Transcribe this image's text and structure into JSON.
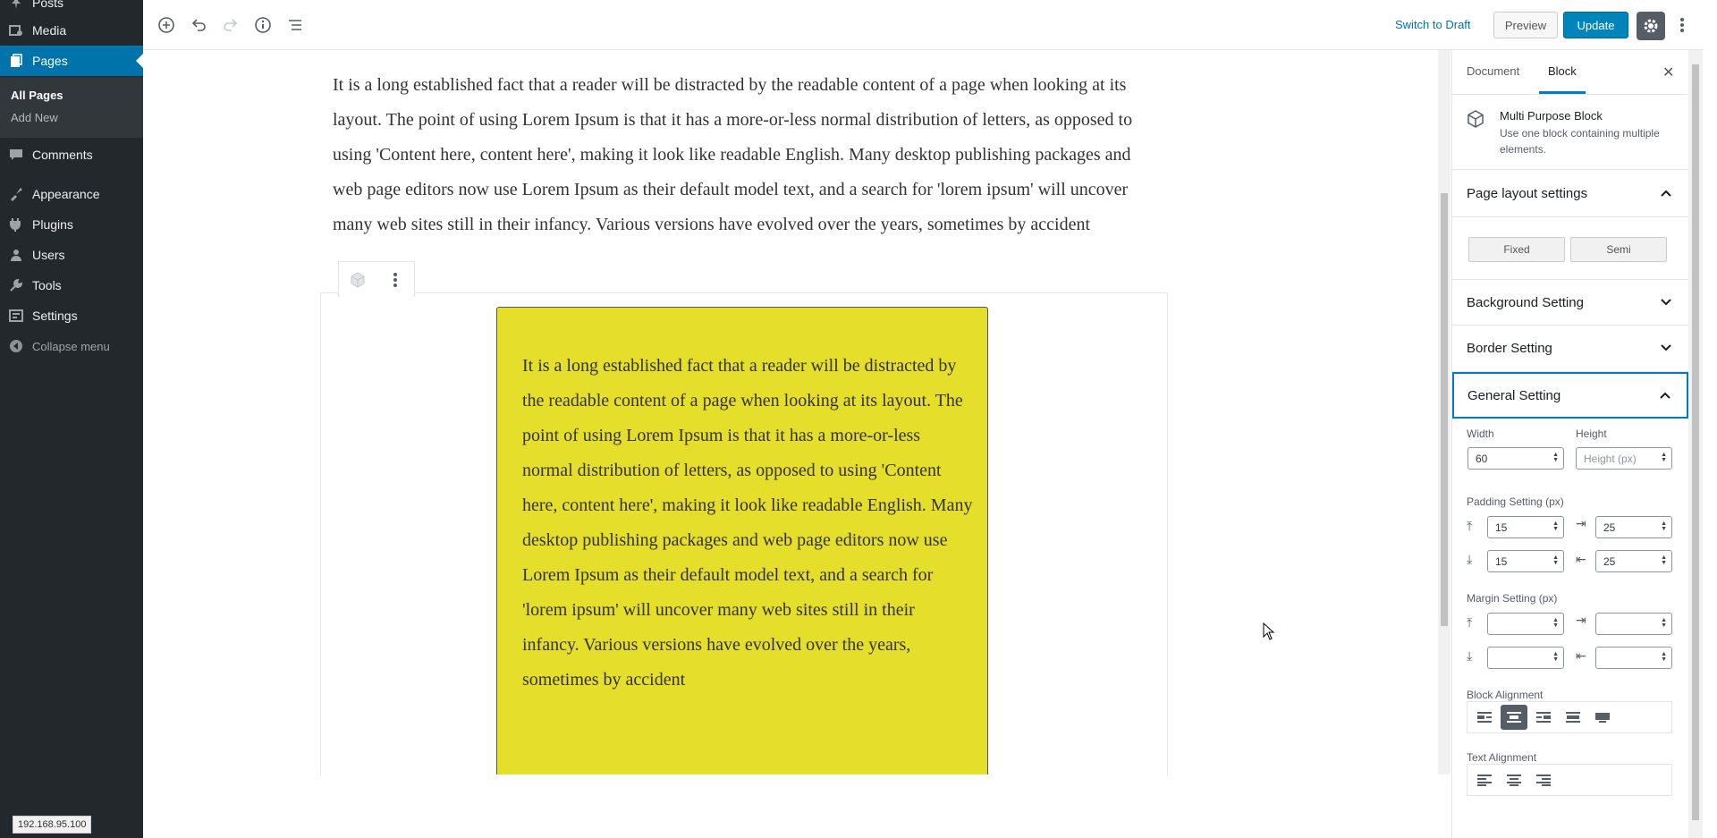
{
  "admin_menu": {
    "items": [
      {
        "label": "Posts",
        "icon": "pushpin-icon"
      },
      {
        "label": "Media",
        "icon": "media-icon"
      },
      {
        "label": "Pages",
        "icon": "pages-icon",
        "current": true
      },
      {
        "label": "Comments",
        "icon": "comments-icon"
      },
      {
        "label": "Appearance",
        "icon": "appearance-icon"
      },
      {
        "label": "Plugins",
        "icon": "plugins-icon"
      },
      {
        "label": "Users",
        "icon": "users-icon"
      },
      {
        "label": "Tools",
        "icon": "tools-icon"
      },
      {
        "label": "Settings",
        "icon": "settings-icon"
      }
    ],
    "submenu": [
      "All Pages",
      "Add New"
    ],
    "collapse_label": "Collapse menu"
  },
  "status_url": "192.168.95.100",
  "toolbar": {
    "switch_draft": "Switch to Draft",
    "preview": "Preview",
    "update": "Update"
  },
  "content": {
    "paragraph": "It is a long established fact that a reader will be distracted by the readable content of a page when looking at its layout. The point of using Lorem Ipsum is that it has a more-or-less normal distribution of letters, as opposed to using 'Content here, content here', making it look like readable English. Many desktop publishing packages and web page editors now use Lorem Ipsum as their default model text, and a search for 'lorem ipsum' will uncover many web sites still in their infancy. Various versions have evolved over the years, sometimes by accident",
    "block_text": " It is a long established fact that a reader will be distracted by the readable content of a page when looking at its layout. The point of using Lorem Ipsum is that it has a more-or-less normal distribution of letters, as opposed to using 'Content here, content here', making it look like readable English. Many desktop publishing packages and web page editors now use Lorem Ipsum as their default model text, and a search for 'lorem ipsum' will uncover many web sites still in their infancy. Various versions have evolved over the years, sometimes by accident",
    "block_color": "#e5de2b"
  },
  "sidebar": {
    "tabs": [
      "Document",
      "Block"
    ],
    "active_tab": "Block",
    "block_title": "Multi Purpose Block",
    "block_desc": "Use one block containing multiple elements.",
    "panels": {
      "page_layout": "Page layout settings",
      "background": "Background Setting",
      "border": "Border Setting",
      "general": "General Setting"
    },
    "layout_buttons": [
      "Fixed",
      "Semi"
    ],
    "width_label": "Width",
    "height_label": "Height",
    "width_value": "60",
    "height_placeholder": "Height (px)",
    "padding_label": "Padding Setting (px)",
    "padding": {
      "top": "15",
      "right": "25",
      "bottom": "15",
      "left": "25"
    },
    "margin_label": "Margin Setting (px)",
    "block_alignment_label": "Block Alignment",
    "text_alignment_label": "Text Alignment"
  },
  "colors": {
    "accent": "#0073aa",
    "admin_bg": "#23282d",
    "update": "#0085ba"
  }
}
